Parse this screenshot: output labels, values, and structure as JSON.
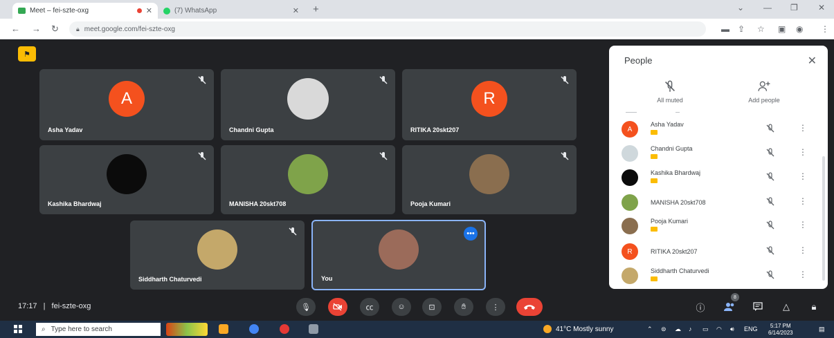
{
  "browser": {
    "tabs": [
      {
        "title": "Meet – fei-szte-oxg",
        "active": true
      },
      {
        "title": "(7) WhatsApp",
        "active": false
      }
    ],
    "url": "meet.google.com/fei-szte-oxg",
    "window_controls": [
      "chevron-down",
      "minimize",
      "restore",
      "close"
    ]
  },
  "meet": {
    "meeting_time": "17:17",
    "separator": "|",
    "meeting_code": "fei-szte-oxg",
    "tiles": [
      {
        "name": "Asha Yadav",
        "initial": "A",
        "avatar_color": "#f4511e",
        "muted": true
      },
      {
        "name": "Chandni Gupta",
        "initial": "",
        "avatar_color": "#d9d9d9",
        "muted": true
      },
      {
        "name": "RITIKA 20skt207",
        "initial": "R",
        "avatar_color": "#f4511e",
        "muted": true
      },
      {
        "name": "Kashika Bhardwaj",
        "initial": "",
        "avatar_color": "#0b0b0b",
        "muted": true
      },
      {
        "name": "MANISHA 20skt708",
        "initial": "",
        "avatar_color": "#7fa34a",
        "muted": true
      },
      {
        "name": "Pooja Kumari",
        "initial": "",
        "avatar_color": "#8a6e4f",
        "muted": true
      },
      {
        "name": "Siddharth Chaturvedi",
        "initial": "",
        "avatar_color": "#c4a86a",
        "muted": true
      },
      {
        "name": "You",
        "initial": "",
        "avatar_color": "#9b6b5a",
        "muted": false,
        "more_label": "•••"
      }
    ],
    "controls": [
      "mic",
      "camera-off",
      "captions",
      "emoji",
      "present",
      "raise-hand",
      "more-options",
      "end-call"
    ],
    "right_controls": {
      "people_count": "8"
    }
  },
  "people_panel": {
    "title": "People",
    "actions": [
      {
        "label": "All muted",
        "icon": "mic-off-icon"
      },
      {
        "label": "Add people",
        "icon": "add-person-icon"
      }
    ],
    "participants": [
      {
        "name": "Asha Yadav",
        "initial": "A",
        "color": "#f4511e",
        "tag": true
      },
      {
        "name": "Chandni Gupta",
        "initial": "",
        "color": "#cfd8dc",
        "tag": true
      },
      {
        "name": "Kashika Bhardwaj",
        "initial": "",
        "color": "#0b0b0b",
        "tag": true
      },
      {
        "name": "MANISHA 20skt708",
        "initial": "",
        "color": "#7fa34a",
        "tag": false
      },
      {
        "name": "Pooja Kumari",
        "initial": "",
        "color": "#8a6e4f",
        "tag": true
      },
      {
        "name": "RITIKA 20skt207",
        "initial": "R",
        "color": "#f4511e",
        "tag": false
      },
      {
        "name": "Siddharth Chaturvedi",
        "initial": "",
        "color": "#c4a86a",
        "tag": true
      }
    ]
  },
  "taskbar": {
    "search_placeholder": "Type here to search",
    "weather": "41°C Mostly sunny",
    "language": "ENG",
    "time": "5:17 PM",
    "date": "6/14/2023"
  }
}
